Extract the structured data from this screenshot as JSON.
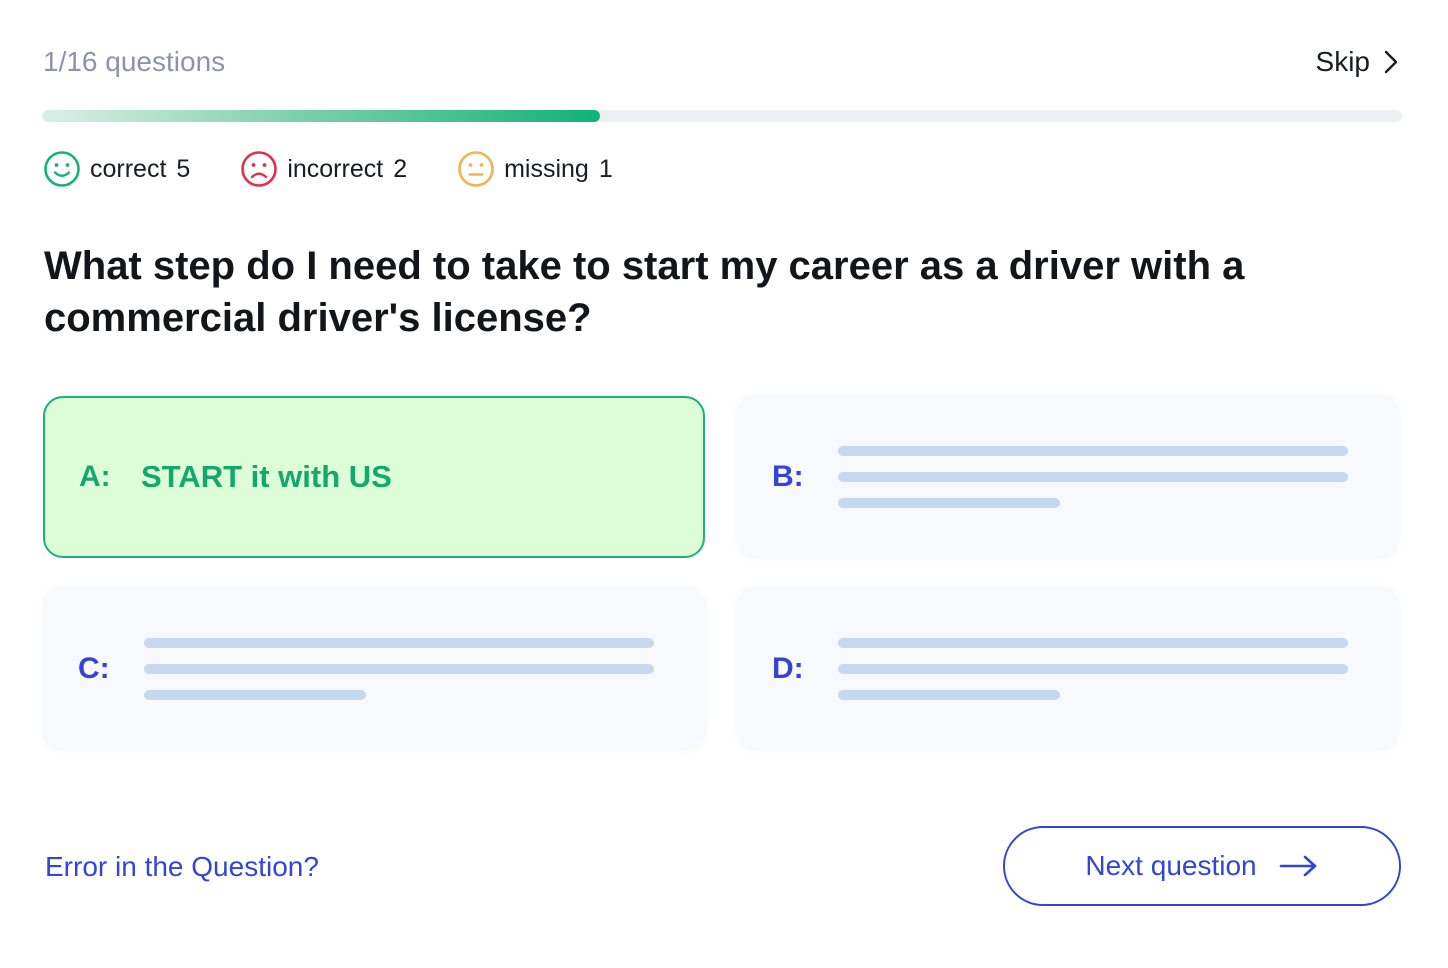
{
  "header": {
    "counter_text": "1/16 questions",
    "skip_label": "Skip"
  },
  "progress": {
    "fraction": 0.41
  },
  "stats": [
    {
      "label": "correct",
      "count": "5",
      "color": "#19b07a",
      "icon": "smile-icon"
    },
    {
      "label": "incorrect",
      "count": "2",
      "color": "#e0314b",
      "icon": "frown-icon"
    },
    {
      "label": "missing",
      "count": "1",
      "color": "#f2b350",
      "icon": "neutral-face-icon"
    }
  ],
  "question": {
    "text": "What step do I need to take to start my career as a driver with a commercial driver's license?"
  },
  "options": [
    {
      "letter": "A:",
      "text": "START it with US",
      "selected": true
    },
    {
      "letter": "B:",
      "text": "",
      "selected": false
    },
    {
      "letter": "C:",
      "text": "",
      "selected": false
    },
    {
      "letter": "D:",
      "text": "",
      "selected": false
    }
  ],
  "footer": {
    "error_link": "Error in the Question?",
    "next_label": "Next question"
  },
  "colors": {
    "accent": "#3444d6",
    "success": "#19b07a",
    "selected_bg": "#dcfdd8",
    "skeleton": "#c4d8ef"
  }
}
